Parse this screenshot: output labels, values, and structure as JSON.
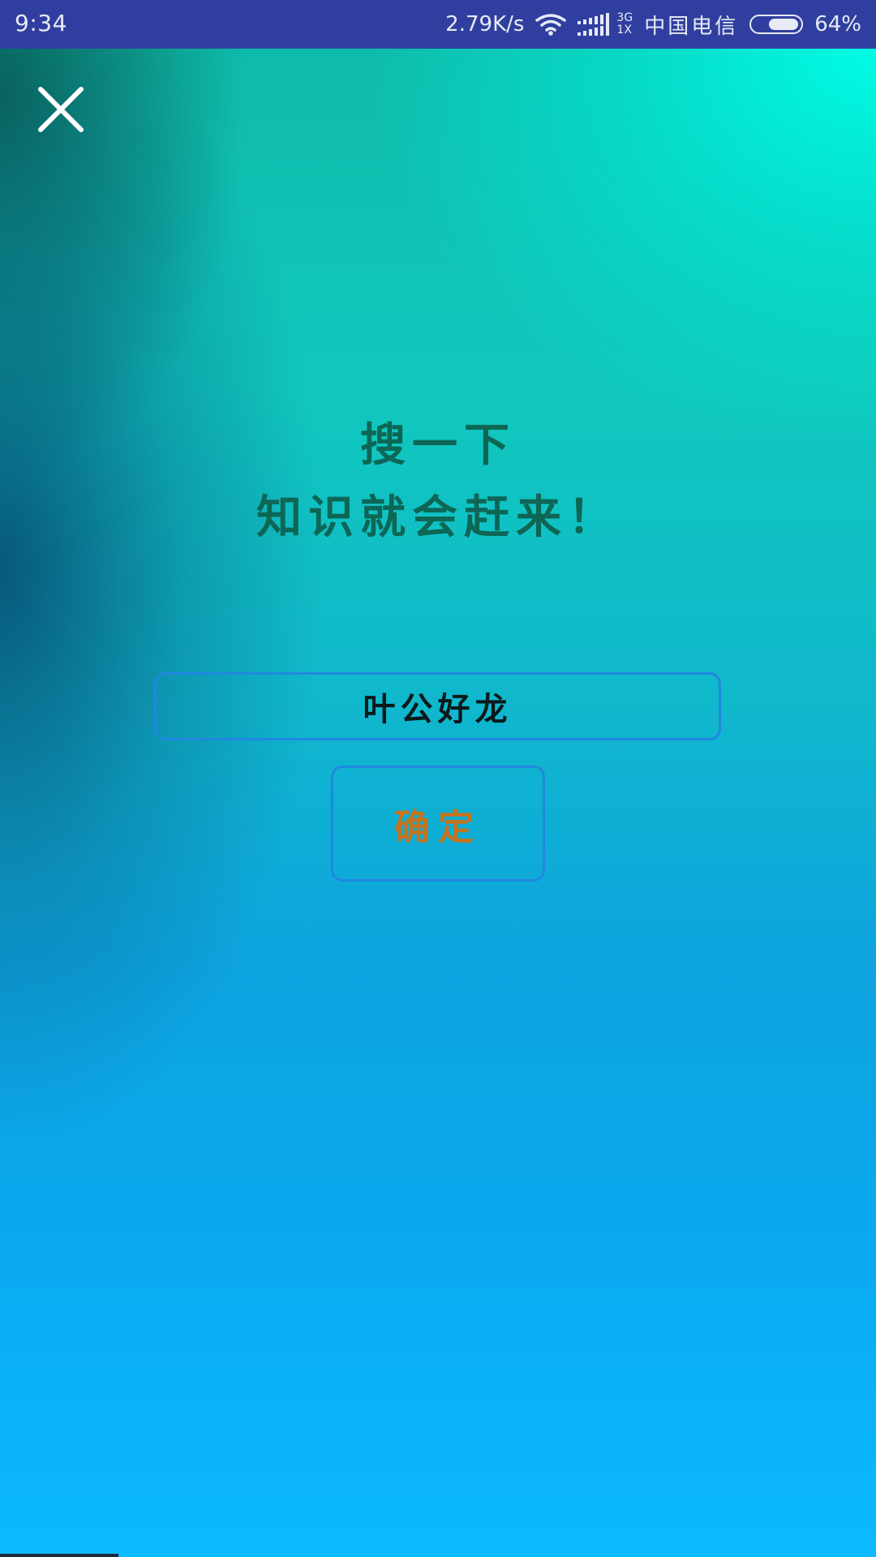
{
  "status_bar": {
    "time": "9:34",
    "net_speed": "2.79K/s",
    "net_type_top": "3G",
    "net_type_bottom": "1X",
    "carrier": "中国电信",
    "battery_percent": "64%",
    "battery_level": 0.64,
    "icons": [
      "wifi-icon",
      "signal-icon",
      "battery-icon"
    ]
  },
  "close": {
    "icon": "close-icon"
  },
  "title": {
    "line1": "搜一下",
    "line2": "知识就会赶来！"
  },
  "search": {
    "value": "叶公好龙"
  },
  "confirm": {
    "label": "确定"
  },
  "colors": {
    "status_bar": "#303f9f",
    "title": "#0e6655",
    "border": "#2188e0",
    "confirm_text": "#c7741e"
  }
}
